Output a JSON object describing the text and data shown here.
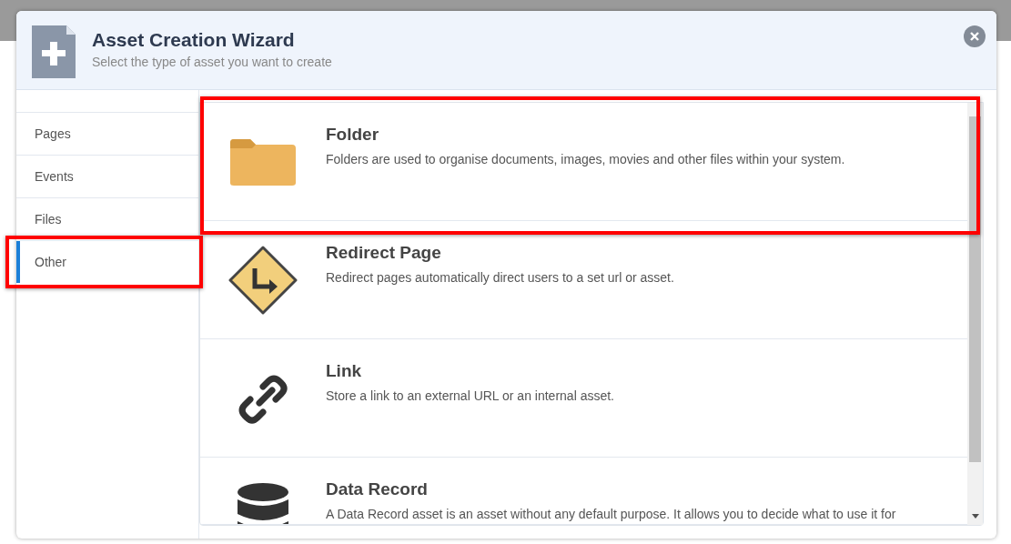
{
  "dialog": {
    "title": "Asset Creation Wizard",
    "subtitle": "Select the type of asset you want to create"
  },
  "categories": [
    {
      "label": "Pages",
      "selected": false,
      "highlighted": false
    },
    {
      "label": "Events",
      "selected": false,
      "highlighted": false
    },
    {
      "label": "Files",
      "selected": false,
      "highlighted": false
    },
    {
      "label": "Other",
      "selected": true,
      "highlighted": true
    }
  ],
  "assets": [
    {
      "kind": "folder",
      "title": "Folder",
      "description": "Folders are used to organise documents, images, movies and other files within your system.",
      "highlighted": true
    },
    {
      "kind": "redirect",
      "title": "Redirect Page",
      "description": "Redirect pages automatically direct users to a set url or asset.",
      "highlighted": false
    },
    {
      "kind": "link",
      "title": "Link",
      "description": "Store a link to an external URL or an internal asset.",
      "highlighted": false
    },
    {
      "kind": "database",
      "title": "Data Record",
      "description": "A Data Record asset is an asset without any default purpose. It allows you to decide what to use it for",
      "highlighted": false
    }
  ]
}
